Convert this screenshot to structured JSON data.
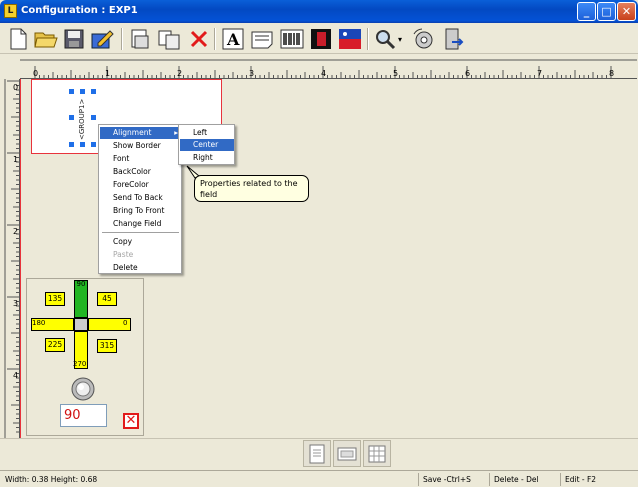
{
  "window": {
    "title": "Configuration : EXP1",
    "icon_letter": "L",
    "minimize": "_",
    "maximize": "□",
    "close": "✕"
  },
  "ruler": {
    "h_ticks": [
      "0",
      "1",
      "2",
      "3",
      "4",
      "5",
      "6",
      "7",
      "8"
    ],
    "v_ticks": [
      "0",
      "1",
      "2",
      "3",
      "4"
    ]
  },
  "field": {
    "label": "<GROUP1>"
  },
  "context_menu": {
    "items": [
      {
        "label": "Alignment",
        "has_submenu": true,
        "selected": true
      },
      {
        "label": "Show Border"
      },
      {
        "label": "Font"
      },
      {
        "label": "BackColor"
      },
      {
        "label": "ForeColor"
      },
      {
        "label": "Send To Back"
      },
      {
        "label": "Bring To Front"
      },
      {
        "label": "Change Field"
      },
      {
        "label": "Copy"
      },
      {
        "label": "Paste",
        "disabled": true
      },
      {
        "label": "Delete"
      }
    ],
    "submenu": [
      "Left",
      "Center",
      "Right"
    ],
    "submenu_selected": "Center",
    "arrow": "▸"
  },
  "tooltip": {
    "text": "Properties related to the field"
  },
  "rotation_panel": {
    "labels": {
      "top": "90",
      "left": "180",
      "right": "0",
      "bottom": "270",
      "tl": "135",
      "tr": "45",
      "bl": "225",
      "br": "315"
    },
    "angle_value": "90",
    "close": "✕"
  },
  "status": {
    "size": "Width: 0.38 Height: 0.68",
    "save": "Save -Ctrl+S",
    "delete": "Delete - Del",
    "edit": "Edit - F2"
  },
  "colors": {
    "title_bar": "#0452d6",
    "selection": "#316ac5",
    "field_border": "#e8333c",
    "label_bg": "#ffff00",
    "top_arrow": "#22b522"
  }
}
